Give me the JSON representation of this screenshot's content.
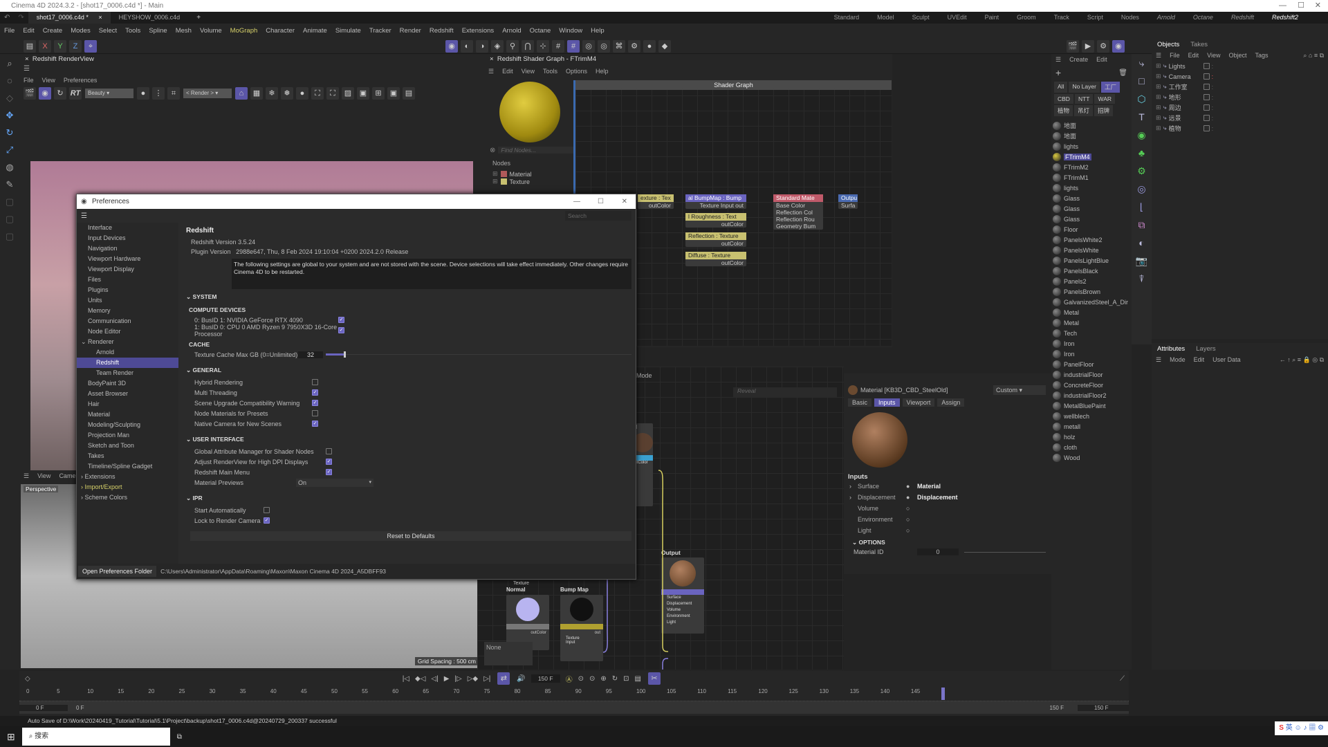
{
  "window": {
    "title": "Cinema 4D 2024.3.2 - [shot17_0006.c4d *] - Main"
  },
  "doc_tabs": [
    {
      "label": "shot17_0006.c4d *"
    },
    {
      "label": "HEYSHOW_0006.c4d"
    }
  ],
  "layouts": [
    "Standard",
    "Model",
    "Sculpt",
    "UVEdit",
    "Paint",
    "Groom",
    "Track",
    "Script",
    "Nodes",
    "Arnold",
    "Octane",
    "Redshift",
    "Redshift2"
  ],
  "menu": [
    "File",
    "Edit",
    "Create",
    "Modes",
    "Select",
    "Tools",
    "Spline",
    "Mesh",
    "Volume",
    "MoGraph",
    "Character",
    "Animate",
    "Simulate",
    "Tracker",
    "Render",
    "Redshift",
    "Extensions",
    "Arnold",
    "Octane",
    "Window",
    "Help"
  ],
  "axis_buttons": [
    "X",
    "Y",
    "Z"
  ],
  "renderview": {
    "title": "Redshift RenderView",
    "menu": [
      "File",
      "View",
      "Preferences"
    ],
    "aov": "Beauty",
    "render_select": "< Render >",
    "rt": "RT"
  },
  "viewport": {
    "menu": [
      "View",
      "Camer"
    ],
    "label": "Perspective",
    "grid": "Grid Spacing : 500 cm"
  },
  "shader_graph": {
    "title": "Redshift Shader Graph - FTrimM4",
    "menu": [
      "Edit",
      "View",
      "Tools",
      "Options",
      "Help"
    ],
    "header": "Shader Graph",
    "find_placeholder": "Find Nodes...",
    "nodes_label": "Nodes",
    "categories": [
      {
        "label": "Material",
        "color": "#b05a5a"
      },
      {
        "label": "Texture",
        "color": "#c8c070"
      }
    ],
    "nodes": [
      {
        "title": "exture : Tex",
        "port": "outColor"
      },
      {
        "title": "al BumpMap : Bump",
        "port": "Texture Input   out"
      },
      {
        "title": "l Roughness : Text",
        "port": "outColor"
      },
      {
        "title": "Reflection : Texture",
        "port": "outColor"
      },
      {
        "title": "Diffuse : Texture",
        "port": "outColor"
      },
      {
        "title": "Standard Mate",
        "ports": [
          "Base Color",
          "Reflection Col",
          "Reflection Rou",
          "Geometry Bum"
        ],
        "out": "outColor"
      },
      {
        "title": "Outpu",
        "port": "Surfa"
      }
    ]
  },
  "node_editor": {
    "mode_label": "Mode",
    "reveal_placeholder": "Reveal",
    "output_node": {
      "title": "Output",
      "ports": [
        "Surface",
        "Displacement",
        "Volume",
        "Environment",
        "Light"
      ]
    },
    "texture_node": {
      "caption": "Texture",
      "title": "Normal",
      "port": "outColor"
    },
    "bump_node": {
      "title": "Bump Map",
      "ports": [
        "Texture",
        "Input"
      ],
      "out": "out"
    },
    "none_label": "None",
    "partial_label": "al",
    "partial_port": "outColor"
  },
  "material_attr": {
    "title": "Material [KB3D_CBD_SteelOld]",
    "preset": "Custom",
    "tabs": [
      "Basic",
      "Inputs",
      "Viewport",
      "Assign"
    ],
    "active_tab": "Inputs",
    "inputs_label": "Inputs",
    "inputs": [
      {
        "label": "Surface",
        "value": "Material"
      },
      {
        "label": "Displacement",
        "value": "Displacement"
      },
      {
        "label": "Volume",
        "value": ""
      },
      {
        "label": "Environment",
        "value": ""
      },
      {
        "label": "Light",
        "value": ""
      }
    ],
    "options_label": "OPTIONS",
    "material_id_label": "Material ID",
    "material_id": "0"
  },
  "materials_panel": {
    "menu": [
      "Create",
      "Edit"
    ],
    "layers": [
      "All",
      "No Layer",
      "工厂",
      "CBD",
      "NTT",
      "WAR",
      "植物",
      "吊灯",
      "招牌"
    ],
    "items": [
      "地面",
      "地面",
      "lights",
      "FTrimM4",
      "FTrimM2",
      "FTrimM1",
      "lights",
      "Glass",
      "Glass",
      "Glass",
      "Floor",
      "PanelsWhite2",
      "PanelsWhite",
      "PanelsLightBlue",
      "PanelsBlack",
      "Panels2",
      "PanelsBrown",
      "GalvanizedSteel_A_Dir",
      "Metal",
      "Metal",
      "Tech",
      "Iron",
      "Iron",
      "PanelFloor",
      "industrialFloor",
      "ConcreteFloor",
      "industrialFloor2",
      "MetalBluePaint",
      "wellblech",
      "metall",
      "holz",
      "cloth",
      "Wood"
    ],
    "selected": "FTrimM4"
  },
  "objects": {
    "tabs": [
      "Objects",
      "Takes"
    ],
    "menu": [
      "File",
      "Edit",
      "View",
      "Object",
      "Tags"
    ],
    "items": [
      "Lights",
      "Camera",
      "工作室",
      "地形",
      "周边",
      "远景",
      "植物"
    ]
  },
  "attributes": {
    "tabs": [
      "Attributes",
      "Layers"
    ],
    "menu": [
      "Mode",
      "Edit",
      "User Data"
    ]
  },
  "preferences": {
    "title": "Preferences",
    "search_placeholder": "Search",
    "sidebar": [
      {
        "label": "Interface"
      },
      {
        "label": "Input Devices"
      },
      {
        "label": "Navigation"
      },
      {
        "label": "Viewport Hardware"
      },
      {
        "label": "Viewport Display"
      },
      {
        "label": "Files"
      },
      {
        "label": "Plugins"
      },
      {
        "label": "Units"
      },
      {
        "label": "Memory"
      },
      {
        "label": "Communication"
      },
      {
        "label": "Node Editor"
      },
      {
        "label": "Renderer",
        "expanded": true
      },
      {
        "label": "Arnold",
        "sub": true
      },
      {
        "label": "Redshift",
        "sub": true,
        "selected": true
      },
      {
        "label": "Team Render",
        "sub": true
      },
      {
        "label": "BodyPaint 3D"
      },
      {
        "label": "Asset Browser"
      },
      {
        "label": "Hair"
      },
      {
        "label": "Material"
      },
      {
        "label": "Modeling/Sculpting"
      },
      {
        "label": "Projection Man"
      },
      {
        "label": "Sketch and Toon"
      },
      {
        "label": "Takes"
      },
      {
        "label": "Timeline/Spline Gadget"
      },
      {
        "label": "Extensions",
        "collapsed": true
      },
      {
        "label": "Import/Export",
        "collapsed": true,
        "highlight": true
      },
      {
        "label": "Scheme Colors",
        "collapsed": true
      }
    ],
    "heading": "Redshift",
    "version_label": "Redshift Version",
    "version": "3.5.24",
    "plugin_label": "Plugin Version",
    "plugin": "2988e647, Thu, 8 Feb 2024 19:10:04 +0200 2024.2.0 Release",
    "notice": "The following settings are global to your system and are not stored with the scene. Device selections will take effect immediately. Other changes require Cinema 4D to be restarted.",
    "system_label": "SYSTEM",
    "compute_label": "COMPUTE DEVICES",
    "devices": [
      {
        "label": "0: BusID 1: NVIDIA GeForce RTX 4090",
        "checked": true
      },
      {
        "label": "1: BusID 0: CPU 0 AMD Ryzen 9 7950X3D 16-Core Processor",
        "checked": true
      }
    ],
    "cache_label": "CACHE",
    "texture_cache_label": "Texture Cache Max GB (0=Unlimited)",
    "texture_cache": "32",
    "general_label": "GENERAL",
    "general": [
      {
        "label": "Hybrid Rendering",
        "checked": false
      },
      {
        "label": "Multi Threading",
        "checked": true
      },
      {
        "label": "Scene Upgrade Compatibility Warning",
        "checked": true
      },
      {
        "label": "Node Materials for Presets",
        "checked": false
      },
      {
        "label": "Native Camera for New Scenes",
        "checked": true
      }
    ],
    "ui_label": "USER INTERFACE",
    "ui": [
      {
        "label": "Global Attribute Manager for Shader Nodes",
        "checked": false
      },
      {
        "label": "Adjust RenderView for High DPI Displays",
        "checked": true
      },
      {
        "label": "Redshift Main Menu",
        "checked": true
      }
    ],
    "material_previews_label": "Material Previews",
    "material_previews": "On",
    "ipr_label": "IPR",
    "ipr": [
      {
        "label": "Start Automatically",
        "checked": false
      },
      {
        "label": "Lock to Render Camera",
        "checked": true
      }
    ],
    "reset_label": "Reset to Defaults",
    "open_folder_label": "Open Preferences Folder",
    "folder_path": "C:\\Users\\Administrator\\AppData\\Roaming\\Maxon\\Maxon Cinema 4D 2024_A5DBFF93"
  },
  "timeline": {
    "frame": "150 F",
    "start": "0 F",
    "start2": "0 F",
    "end": "150 F",
    "end2": "150 F",
    "ticks": [
      "0",
      "5",
      "10",
      "15",
      "20",
      "25",
      "30",
      "35",
      "40",
      "45",
      "50",
      "55",
      "60",
      "65",
      "70",
      "75",
      "80",
      "85",
      "90",
      "95",
      "100",
      "105",
      "110",
      "115",
      "120",
      "125",
      "130",
      "135",
      "140",
      "145"
    ]
  },
  "status": {
    "message": "Auto Save of D:\\Work\\20240419_Tutorial\\Tutorial\\5.1\\Project\\backup\\shot17_0006.c4d@20240729_200337 successful"
  },
  "taskbar": {
    "search": "搜索",
    "ime": "英"
  },
  "colors": {
    "accent": "#5b56a8",
    "highlight": "#d8d26a",
    "selection": "#4e4a96"
  }
}
